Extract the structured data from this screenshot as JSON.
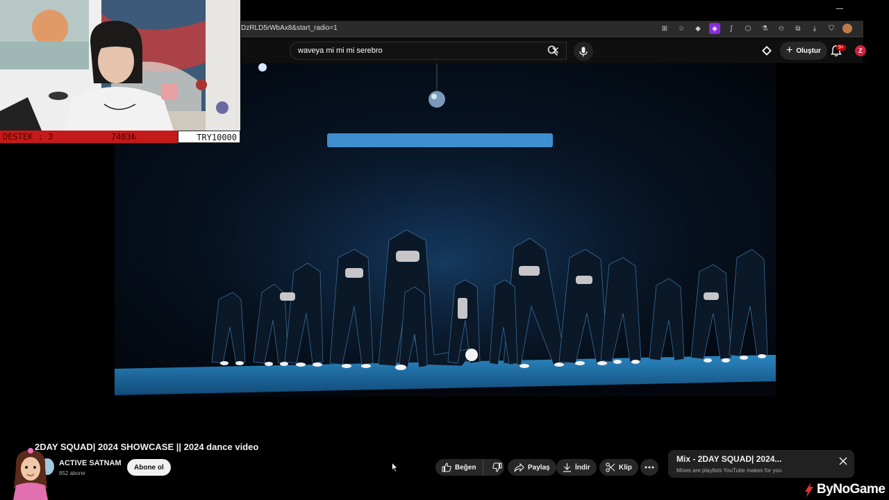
{
  "browser": {
    "url_fragment": "DzRLD5rWbAx8&start_radio=1"
  },
  "masthead": {
    "search_query": "waveya mi mi mi serebro",
    "create_label": "Oluştur",
    "notification_badge": "9+",
    "account_initial": "Z"
  },
  "webcam": {
    "destek_label": "DESTEK : 3",
    "amount": "7403₺",
    "goal": "TRY10000"
  },
  "video": {
    "title": "2DAY SQUAD| 2024 SHOWCASE || 2024 dance video"
  },
  "channel": {
    "name": "ACTIVE SATNAM",
    "subscribers": "852 abone",
    "subscribe_label": "Abone ol"
  },
  "actions": {
    "like_label": "Beğen",
    "share_label": "Paylaş",
    "download_label": "İndir",
    "clip_label": "Klip",
    "more_icon": "more-horizontal-icon"
  },
  "mix": {
    "title": "Mix - 2DAY SQUAD| 2024...",
    "subtitle": "Mixes are playlists YouTube makes for you"
  },
  "watermark": {
    "brand": "ByNoGame"
  },
  "colors": {
    "youtube_bg": "#0f0f0f",
    "pill_bg": "#272727",
    "accent_red": "#cc0000",
    "stage_blue": "#1f6fa8",
    "overlay_red": "#c41a1a"
  }
}
